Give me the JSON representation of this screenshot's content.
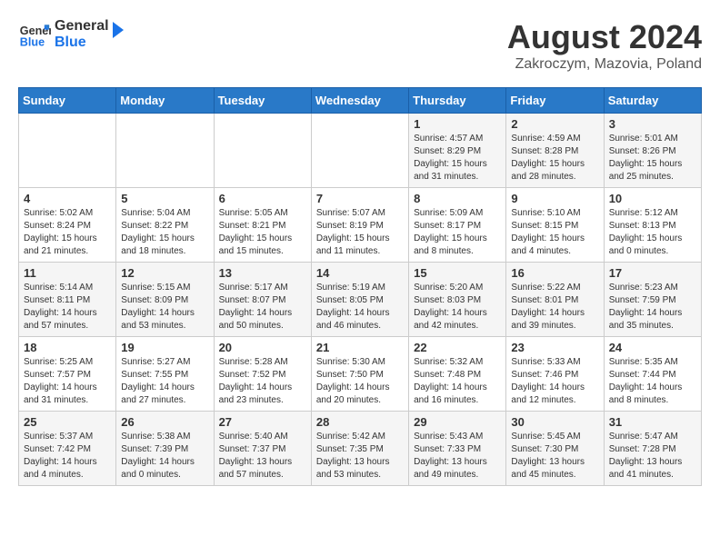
{
  "logo": {
    "line1": "General",
    "line2": "Blue"
  },
  "title": "August 2024",
  "subtitle": "Zakroczym, Mazovia, Poland",
  "weekdays": [
    "Sunday",
    "Monday",
    "Tuesday",
    "Wednesday",
    "Thursday",
    "Friday",
    "Saturday"
  ],
  "weeks": [
    [
      {
        "day": "",
        "info": ""
      },
      {
        "day": "",
        "info": ""
      },
      {
        "day": "",
        "info": ""
      },
      {
        "day": "",
        "info": ""
      },
      {
        "day": "1",
        "info": "Sunrise: 4:57 AM\nSunset: 8:29 PM\nDaylight: 15 hours\nand 31 minutes."
      },
      {
        "day": "2",
        "info": "Sunrise: 4:59 AM\nSunset: 8:28 PM\nDaylight: 15 hours\nand 28 minutes."
      },
      {
        "day": "3",
        "info": "Sunrise: 5:01 AM\nSunset: 8:26 PM\nDaylight: 15 hours\nand 25 minutes."
      }
    ],
    [
      {
        "day": "4",
        "info": "Sunrise: 5:02 AM\nSunset: 8:24 PM\nDaylight: 15 hours\nand 21 minutes."
      },
      {
        "day": "5",
        "info": "Sunrise: 5:04 AM\nSunset: 8:22 PM\nDaylight: 15 hours\nand 18 minutes."
      },
      {
        "day": "6",
        "info": "Sunrise: 5:05 AM\nSunset: 8:21 PM\nDaylight: 15 hours\nand 15 minutes."
      },
      {
        "day": "7",
        "info": "Sunrise: 5:07 AM\nSunset: 8:19 PM\nDaylight: 15 hours\nand 11 minutes."
      },
      {
        "day": "8",
        "info": "Sunrise: 5:09 AM\nSunset: 8:17 PM\nDaylight: 15 hours\nand 8 minutes."
      },
      {
        "day": "9",
        "info": "Sunrise: 5:10 AM\nSunset: 8:15 PM\nDaylight: 15 hours\nand 4 minutes."
      },
      {
        "day": "10",
        "info": "Sunrise: 5:12 AM\nSunset: 8:13 PM\nDaylight: 15 hours\nand 0 minutes."
      }
    ],
    [
      {
        "day": "11",
        "info": "Sunrise: 5:14 AM\nSunset: 8:11 PM\nDaylight: 14 hours\nand 57 minutes."
      },
      {
        "day": "12",
        "info": "Sunrise: 5:15 AM\nSunset: 8:09 PM\nDaylight: 14 hours\nand 53 minutes."
      },
      {
        "day": "13",
        "info": "Sunrise: 5:17 AM\nSunset: 8:07 PM\nDaylight: 14 hours\nand 50 minutes."
      },
      {
        "day": "14",
        "info": "Sunrise: 5:19 AM\nSunset: 8:05 PM\nDaylight: 14 hours\nand 46 minutes."
      },
      {
        "day": "15",
        "info": "Sunrise: 5:20 AM\nSunset: 8:03 PM\nDaylight: 14 hours\nand 42 minutes."
      },
      {
        "day": "16",
        "info": "Sunrise: 5:22 AM\nSunset: 8:01 PM\nDaylight: 14 hours\nand 39 minutes."
      },
      {
        "day": "17",
        "info": "Sunrise: 5:23 AM\nSunset: 7:59 PM\nDaylight: 14 hours\nand 35 minutes."
      }
    ],
    [
      {
        "day": "18",
        "info": "Sunrise: 5:25 AM\nSunset: 7:57 PM\nDaylight: 14 hours\nand 31 minutes."
      },
      {
        "day": "19",
        "info": "Sunrise: 5:27 AM\nSunset: 7:55 PM\nDaylight: 14 hours\nand 27 minutes."
      },
      {
        "day": "20",
        "info": "Sunrise: 5:28 AM\nSunset: 7:52 PM\nDaylight: 14 hours\nand 23 minutes."
      },
      {
        "day": "21",
        "info": "Sunrise: 5:30 AM\nSunset: 7:50 PM\nDaylight: 14 hours\nand 20 minutes."
      },
      {
        "day": "22",
        "info": "Sunrise: 5:32 AM\nSunset: 7:48 PM\nDaylight: 14 hours\nand 16 minutes."
      },
      {
        "day": "23",
        "info": "Sunrise: 5:33 AM\nSunset: 7:46 PM\nDaylight: 14 hours\nand 12 minutes."
      },
      {
        "day": "24",
        "info": "Sunrise: 5:35 AM\nSunset: 7:44 PM\nDaylight: 14 hours\nand 8 minutes."
      }
    ],
    [
      {
        "day": "25",
        "info": "Sunrise: 5:37 AM\nSunset: 7:42 PM\nDaylight: 14 hours\nand 4 minutes."
      },
      {
        "day": "26",
        "info": "Sunrise: 5:38 AM\nSunset: 7:39 PM\nDaylight: 14 hours\nand 0 minutes."
      },
      {
        "day": "27",
        "info": "Sunrise: 5:40 AM\nSunset: 7:37 PM\nDaylight: 13 hours\nand 57 minutes."
      },
      {
        "day": "28",
        "info": "Sunrise: 5:42 AM\nSunset: 7:35 PM\nDaylight: 13 hours\nand 53 minutes."
      },
      {
        "day": "29",
        "info": "Sunrise: 5:43 AM\nSunset: 7:33 PM\nDaylight: 13 hours\nand 49 minutes."
      },
      {
        "day": "30",
        "info": "Sunrise: 5:45 AM\nSunset: 7:30 PM\nDaylight: 13 hours\nand 45 minutes."
      },
      {
        "day": "31",
        "info": "Sunrise: 5:47 AM\nSunset: 7:28 PM\nDaylight: 13 hours\nand 41 minutes."
      }
    ]
  ]
}
